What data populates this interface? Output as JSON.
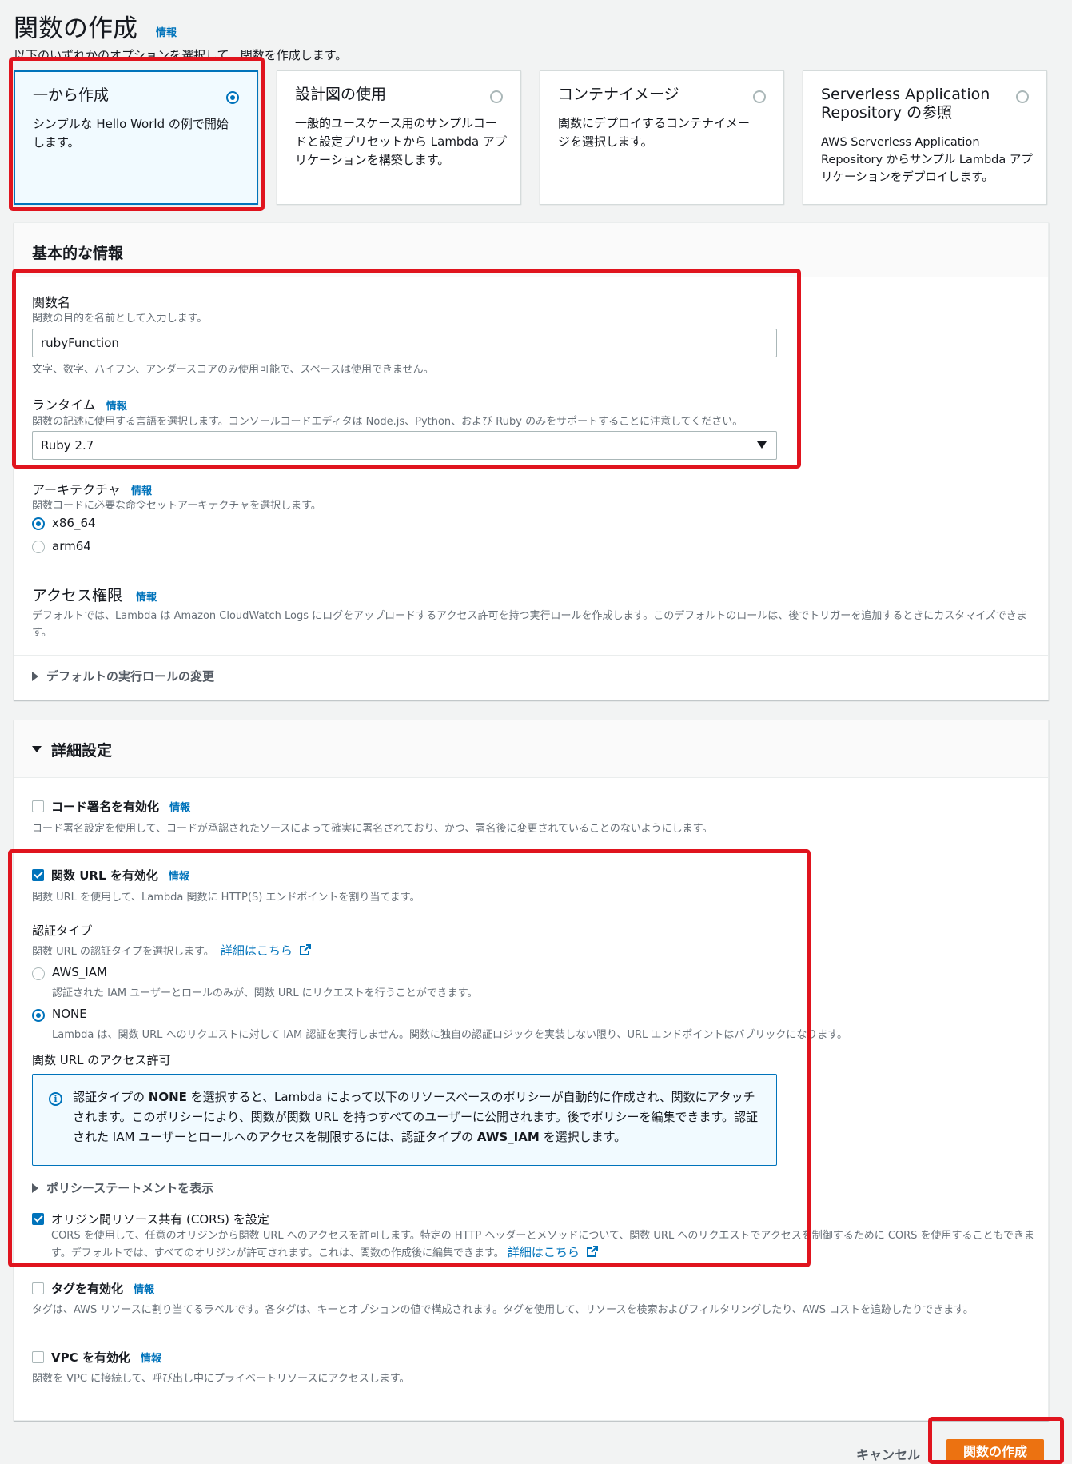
{
  "header": {
    "title": "関数の作成",
    "info": "情報",
    "subtitle": "以下のいずれかのオプションを選択して、関数を作成します。"
  },
  "options": [
    {
      "title": "一から作成",
      "desc": "シンプルな Hello World の例で開始します。",
      "selected": true
    },
    {
      "title": "設計図の使用",
      "desc": "一般的ユースケース用のサンプルコードと設定プリセットから Lambda アプリケーションを構築します。",
      "selected": false
    },
    {
      "title": "コンテナイメージ",
      "desc": "関数にデプロイするコンテナイメージを選択します。",
      "selected": false
    },
    {
      "title": "Serverless Application Repository の参照",
      "desc": "AWS Serverless Application Repository からサンプル Lambda アプリケーションをデプロイします。",
      "selected": false
    }
  ],
  "basic": {
    "title": "基本的な情報",
    "function_name": {
      "label": "関数名",
      "desc": "関数の目的を名前として入力します。",
      "value": "rubyFunction",
      "constraint": "文字、数字、ハイフン、アンダースコアのみ使用可能で、スペースは使用できません。"
    },
    "runtime": {
      "label": "ランタイム",
      "info": "情報",
      "desc": "関数の記述に使用する言語を選択します。コンソールコードエディタは Node.js、Python、および Ruby のみをサポートすることに注意してください。",
      "value": "Ruby 2.7"
    },
    "architecture": {
      "label": "アーキテクチャ",
      "info": "情報",
      "desc": "関数コードに必要な命令セットアーキテクチャを選択します。",
      "options": [
        "x86_64",
        "arm64"
      ],
      "selected": "x86_64"
    },
    "permissions": {
      "label": "アクセス権限",
      "info": "情報",
      "desc": "デフォルトでは、Lambda は Amazon CloudWatch Logs にログをアップロードするアクセス許可を持つ実行ロールを作成します。このデフォルトのロールは、後でトリガーを追加するときにカスタマイズできます。",
      "expander": "デフォルトの実行ロールの変更"
    }
  },
  "advanced": {
    "title": "詳細設定",
    "code_signing": {
      "label": "コード署名を有効化",
      "info": "情報",
      "desc": "コード署名設定を使用して、コードが承認されたソースによって確実に署名されており、かつ、署名後に変更されていることのないようにします。",
      "checked": false
    },
    "function_url": {
      "label": "関数 URL を有効化",
      "info": "情報",
      "desc": "関数 URL を使用して、Lambda 関数に HTTP(S) エンドポイントを割り当てます。",
      "checked": true,
      "auth_type_label": "認証タイプ",
      "auth_type_desc": "関数 URL の認証タイプを選択します。",
      "auth_type_link": "詳細はこちら",
      "auth_options": [
        {
          "value": "AWS_IAM",
          "desc": "認証された IAM ユーザーとロールのみが、関数 URL にリクエストを行うことができます。",
          "selected": false
        },
        {
          "value": "NONE",
          "desc": "Lambda は、関数 URL へのリクエストに対して IAM 認証を実行しません。関数に独自の認証ロジックを実装しない限り、URL エンドポイントはパブリックになります。",
          "selected": true
        }
      ],
      "permission_label": "関数 URL のアクセス許可",
      "info_box": {
        "part1": "認証タイプの ",
        "bold1": "NONE",
        "part2": " を選択すると、Lambda によって以下のリソースベースのポリシーが自動的に作成され、関数にアタッチされます。このポリシーにより、関数が関数 URL を持つすべてのユーザーに公開されます。後でポリシーを編集できます。認証された IAM ユーザーとロールへのアクセスを制限するには、認証タイプの ",
        "bold2": "AWS_IAM",
        "part3": " を選択します。"
      },
      "policy_expander": "ポリシーステートメントを表示",
      "cors": {
        "label": "オリジン間リソース共有 (CORS) を設定",
        "desc": "CORS を使用して、任意のオリジンから関数 URL へのアクセスを許可します。特定の HTTP ヘッダーとメソッドについて、関数 URL へのリクエストでアクセスを制御するために CORS を使用することもできます。デフォルトでは、すべてのオリジンが許可されます。これは、関数の作成後に編集できます。",
        "link": "詳細はこちら",
        "checked": true
      }
    },
    "tags": {
      "label": "タグを有効化",
      "info": "情報",
      "desc": "タグは、AWS リソースに割り当てるラベルです。各タグは、キーとオプションの値で構成されます。タグを使用して、リソースを検索およびフィルタリングしたり、AWS コストを追跡したりできます。",
      "checked": false
    },
    "vpc": {
      "label": "VPC を有効化",
      "info": "情報",
      "desc": "関数を VPC に接続して、呼び出し中にプライベートリソースにアクセスします。",
      "checked": false
    }
  },
  "footer": {
    "cancel": "キャンセル",
    "create": "関数の作成"
  },
  "colors": {
    "accent": "#0073bb",
    "primary_button": "#ec7211",
    "highlight": "#e0141e"
  }
}
